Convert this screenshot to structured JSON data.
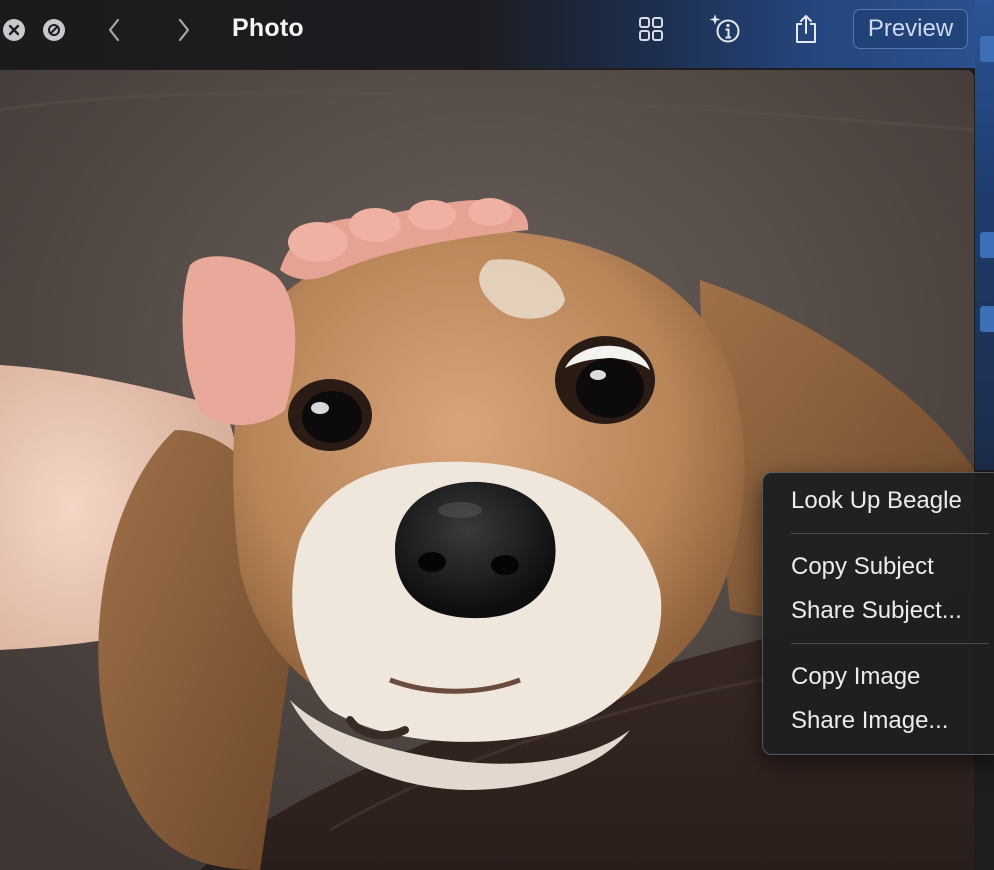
{
  "window": {
    "title": "Photo",
    "preview_label": "Preview"
  },
  "toolbar": {
    "close": "close-icon",
    "hide": "prohibit-icon",
    "back": "chevron-left-icon",
    "forward": "chevron-right-icon",
    "grid": "grid-icon",
    "visual_lookup": "sparkle-info-icon",
    "share": "share-icon"
  },
  "photo": {
    "subject": "beagle"
  },
  "context_menu": {
    "items": [
      {
        "label": "Look Up Beagle"
      },
      {
        "label": "Copy Subject"
      },
      {
        "label": "Share Subject..."
      },
      {
        "label": "Copy Image"
      },
      {
        "label": "Share Image..."
      }
    ]
  },
  "colors": {
    "accent": "#2a5190",
    "menu_bg": "#1e1e20",
    "menu_text": "#ececee"
  }
}
